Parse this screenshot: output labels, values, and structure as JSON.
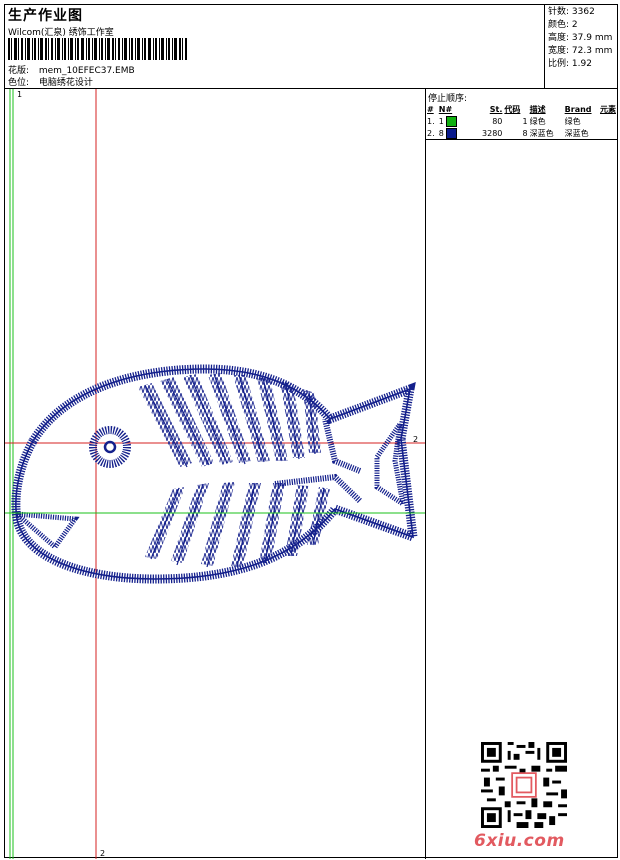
{
  "header": {
    "title": "生产作业图",
    "studio": "Wilcom(汇泉) 绣饰工作室",
    "design_label": "花版:",
    "design_value": "mem_10EFEC37.EMB",
    "color_label": "色位:",
    "color_value": "电脑绣花设计"
  },
  "specs": [
    {
      "label": "针数:",
      "value": "3362"
    },
    {
      "label": "颜色:",
      "value": "2"
    },
    {
      "label": "高度:",
      "value": "37.9 mm"
    },
    {
      "label": "宽度:",
      "value": "72.3 mm"
    },
    {
      "label": "比例:",
      "value": "1.92"
    }
  ],
  "stop_sequence": {
    "title": "停止顺序:",
    "columns": [
      "#",
      "N#",
      "St.",
      "代码",
      "描述",
      "Brand",
      "元素"
    ],
    "rows": [
      {
        "index": "1.",
        "n": "1",
        "color": "#10b010",
        "stitches": "80",
        "code": "1",
        "desc": "绿色",
        "brand": "绿色",
        "element": ""
      },
      {
        "index": "2.",
        "n": "8",
        "color": "#0a1a8c",
        "stitches": "3280",
        "code": "8",
        "desc": "深蓝色",
        "brand": "深蓝色",
        "element": ""
      }
    ]
  },
  "canvas": {
    "marker_top": "1",
    "marker_bottom": "2",
    "marker_right": "2",
    "stitch_color": "#14208c",
    "guide_red": "#d42020",
    "guide_green": "#18c018"
  },
  "watermark": "6xiu.com"
}
